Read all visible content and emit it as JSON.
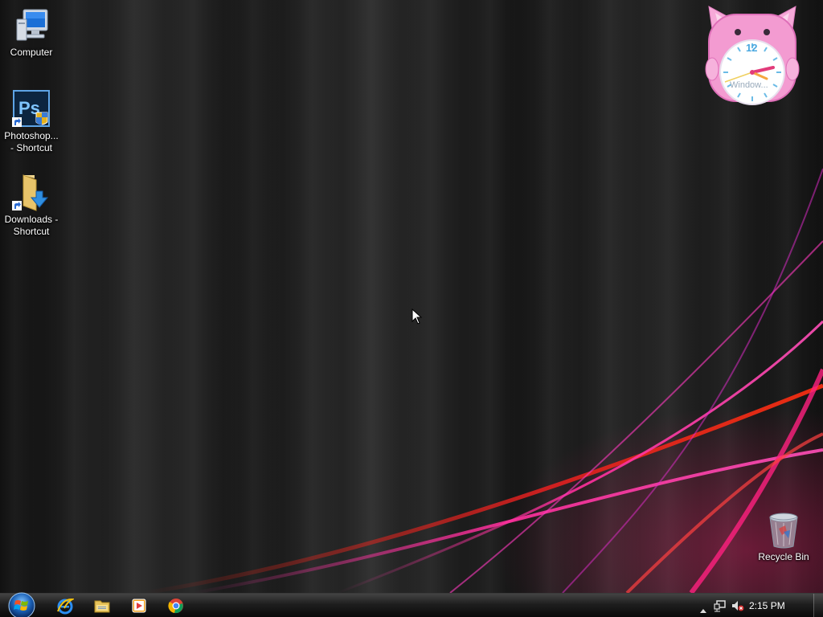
{
  "desktop": {
    "icons": [
      {
        "label": "Computer",
        "icon": "computer-icon"
      },
      {
        "label_line1": "Photoshop...",
        "label_line2": "- Shortcut",
        "icon": "photoshop-shortcut-icon"
      },
      {
        "label_line1": "Downloads -",
        "label_line2": "Shortcut",
        "icon": "downloads-folder-shortcut-icon"
      },
      {
        "label": "Recycle Bin",
        "icon": "recycle-bin-icon"
      }
    ],
    "clock_gadget": {
      "numeral_12": "12",
      "brand_text": "Window...",
      "icon": "pink-cat-clock-icon"
    }
  },
  "taskbar": {
    "start_icon": "windows-start-orb-icon",
    "pinned": [
      {
        "icon": "internet-explorer-icon"
      },
      {
        "icon": "file-explorer-icon"
      },
      {
        "icon": "media-player-icon"
      },
      {
        "icon": "chrome-icon"
      }
    ],
    "tray": {
      "icons": [
        "show-hidden-icons-arrow",
        "network-icon",
        "volume-muted-icon"
      ],
      "clock": "2:15 PM"
    }
  },
  "colors": {
    "accent_pink": "#e0237d",
    "accent_red": "#c8201c",
    "clock_pink": "#f29ad0",
    "taskbar": "#1a1a1a"
  }
}
